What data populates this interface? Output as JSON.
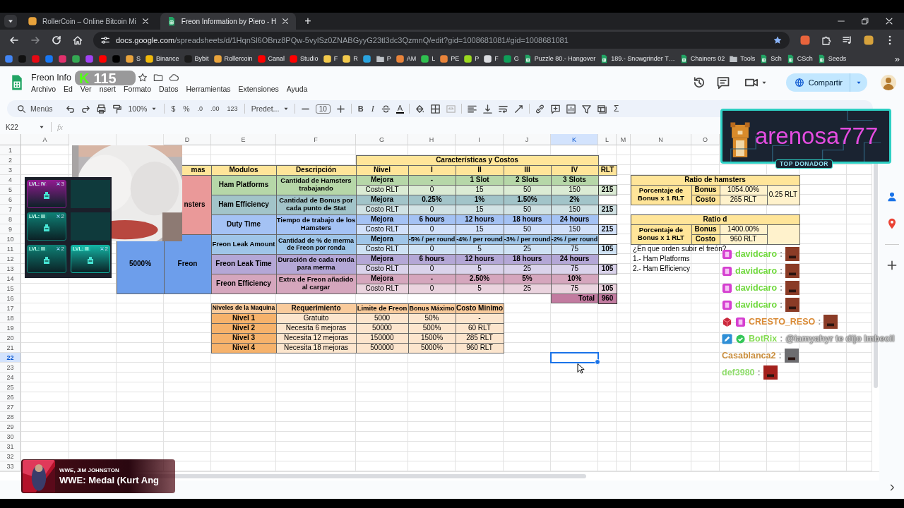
{
  "browser": {
    "tabs": [
      {
        "title": "RollerCoin – Online Bitcoin Mi",
        "kind": "site",
        "color": "#e8a33c",
        "selected": false
      },
      {
        "title": "Freon Information by Piero - H",
        "kind": "sheet",
        "color": "#21a464",
        "selected": true
      }
    ],
    "new_tab": "+",
    "url_host": "docs.google.com",
    "url_path": "/spreadsheets/d/1HqnSl6OBnz8PQw-5vylSz0ZNABGyyG23tl3dc3QzmnQ/edit?gid=1008681081#gid=1008681081",
    "bookmarks": [
      {
        "kind": "site",
        "color": "#4285f4"
      },
      {
        "kind": "site",
        "color": "#111111"
      },
      {
        "kind": "site",
        "color": "#e50914"
      },
      {
        "kind": "site",
        "color": "#1877f2"
      },
      {
        "kind": "site",
        "color": "#e1306c"
      },
      {
        "kind": "site",
        "color": "#34a853"
      },
      {
        "kind": "site",
        "color": "#a142f4"
      },
      {
        "kind": "site",
        "color": "#ff0000"
      },
      {
        "kind": "site",
        "color": "#000000"
      },
      {
        "kind": "site",
        "color": "#e8a33c",
        "label": "S"
      },
      {
        "kind": "site",
        "color": "#f0b90b",
        "label": "Binance"
      },
      {
        "kind": "site",
        "color": "#1b1b1b",
        "label": "Bybit"
      },
      {
        "kind": "site",
        "color": "#e8a33c",
        "label": "Rollercoin"
      },
      {
        "kind": "site",
        "color": "#ff0000",
        "label": "Canal"
      },
      {
        "kind": "site",
        "color": "#ff0000",
        "label": "Studio"
      },
      {
        "kind": "site",
        "color": "#f2c94c",
        "label": "F"
      },
      {
        "kind": "site",
        "color": "#f2c94c",
        "label": "R"
      },
      {
        "kind": "site",
        "color": "#2aa3de"
      },
      {
        "kind": "folder",
        "color": "#bdc1c6",
        "label": "P"
      },
      {
        "kind": "site",
        "color": "#e8833a",
        "label": "AM"
      },
      {
        "kind": "site",
        "color": "#2fbf4f",
        "label": "L"
      },
      {
        "kind": "site",
        "color": "#e8833a",
        "label": "PE"
      },
      {
        "kind": "site",
        "color": "#9ad81f",
        "label": "P"
      },
      {
        "kind": "site",
        "color": "#dadce0",
        "label": "F"
      },
      {
        "kind": "site",
        "color": "#0f9d58",
        "label": "G"
      },
      {
        "kind": "sheet",
        "color": "#21a464",
        "label": "Puzzle 80.- Hangover"
      },
      {
        "kind": "sheet",
        "color": "#21a464",
        "label": "189.- Snowgrinder T…"
      },
      {
        "kind": "sheet",
        "color": "#21a464",
        "label": "Chainers 02"
      },
      {
        "kind": "folder",
        "color": "#bdc1c6",
        "label": "Tools"
      },
      {
        "kind": "sheet",
        "color": "#21a464",
        "label": "Sch"
      },
      {
        "kind": "sheet",
        "color": "#21a464",
        "label": "CSch"
      },
      {
        "kind": "sheet",
        "color": "#21a464",
        "label": "Seeds"
      }
    ],
    "more": "»"
  },
  "document": {
    "title": "Freon Info",
    "menus": [
      "Archivo",
      "Ed",
      "Ver",
      "nsert",
      "Formato",
      "Datos",
      "Herramientas",
      "Extensiones",
      "Ayuda"
    ],
    "share": "Compartir"
  },
  "toolbar": {
    "search": "Menús",
    "zoom": "100%",
    "currency": "$",
    "percent": "%",
    "decrease_decimals": ".0",
    "increase_decimals": ".00",
    "number_format": "123",
    "font": "Predet...",
    "font_size": "10",
    "bold": "B",
    "italic": "I",
    "text_color": "A",
    "functions": "Σ"
  },
  "formula_bar": {
    "cell": "K22",
    "fx": "fx"
  },
  "sheet": {
    "columns": [
      {
        "header": "A",
        "selected": false
      },
      {},
      {},
      {
        "header": "D",
        "selected": false
      },
      {
        "header": "E",
        "selected": false
      },
      {
        "header": "F",
        "selected": false
      },
      {
        "header": "G",
        "selected": false
      },
      {
        "header": "H",
        "selected": false
      },
      {
        "header": "I",
        "selected": false
      },
      {
        "header": "J",
        "selected": false
      },
      {
        "header": "K",
        "selected": true
      },
      {
        "header": "L",
        "selected": false
      },
      {
        "header": "M",
        "selected": false
      },
      {
        "header": "N",
        "selected": false
      },
      {
        "header": "O",
        "selected": false
      },
      {},
      {},
      {},
      {}
    ],
    "rows": [
      {
        "number": "1",
        "selected": false
      },
      {
        "number": "2",
        "selected": false
      },
      {
        "number": "3",
        "selected": false
      },
      {
        "number": "4",
        "selected": false
      },
      {
        "number": "5",
        "selected": false
      },
      {
        "number": "6",
        "selected": false
      },
      {
        "number": "7",
        "selected": false
      },
      {
        "number": "8",
        "selected": false
      },
      {
        "number": "9",
        "selected": false
      },
      {
        "number": "10",
        "selected": false
      },
      {
        "number": "11",
        "selected": false
      },
      {
        "number": "12",
        "selected": false
      },
      {
        "number": "13",
        "selected": false
      },
      {
        "number": "14",
        "selected": false
      },
      {
        "number": "15",
        "selected": false
      },
      {
        "number": "16",
        "selected": false
      },
      {
        "number": "17",
        "selected": false
      },
      {
        "number": "18",
        "selected": false
      },
      {
        "number": "19",
        "selected": false
      },
      {
        "number": "20",
        "selected": false
      },
      {
        "number": "21",
        "selected": false
      },
      {
        "number": "22",
        "selected": true
      },
      {
        "number": "23",
        "selected": false
      },
      {
        "number": "24",
        "selected": false
      },
      {
        "number": "25",
        "selected": false
      },
      {
        "number": "26",
        "selected": false
      },
      {
        "number": "27",
        "selected": false
      },
      {
        "number": "28",
        "selected": false
      },
      {
        "number": "29",
        "selected": false
      },
      {
        "number": "30",
        "selected": false
      },
      {
        "number": "31",
        "selected": false
      },
      {
        "number": "32",
        "selected": false
      },
      {
        "number": "33",
        "selected": false
      }
    ],
    "main_table": {
      "title": "Características y Costos",
      "headers": [
        "mas",
        "Modulos",
        "Descripción",
        "Nivel",
        "I",
        "II",
        "III",
        "IV",
        "RLT"
      ],
      "categories": [
        {
          "name": "nsters",
          "color": "#ea9999",
          "modules": [
            {
              "name": "Ham Platforms",
              "description": "Cantidad de Hamsters trabajando",
              "color": "#b6d7a8",
              "upgrade_label": "Mejora",
              "upgrades": [
                "-",
                "1 Slot",
                "2 Slots",
                "3 Slots"
              ],
              "cost_label": "Costo RLT",
              "costs": [
                "0",
                "15",
                "50",
                "150"
              ],
              "total": "215"
            },
            {
              "name": "Ham Efficiency",
              "description": "Cantidad de Bonus por cada punto de Stat",
              "color": "#a2c4c9",
              "upgrade_label": "Mejora",
              "upgrades": [
                "0.25%",
                "1%",
                "1.50%",
                "2%"
              ],
              "cost_label": "Costo RLT",
              "costs": [
                "0",
                "15",
                "50",
                "150"
              ],
              "total": "215"
            },
            {
              "name": "Duty Time",
              "description": "Tiempo de trabajo de los Hamsters",
              "color": "#a4c2f4",
              "upgrade_label": "Mejora",
              "upgrades": [
                "6 hours",
                "12 hours",
                "18 hours",
                "24 hours"
              ],
              "cost_label": "Costo RLT",
              "costs": [
                "0",
                "15",
                "50",
                "150"
              ],
              "total": "215"
            }
          ]
        },
        {
          "value": "5000%",
          "name": "Freon",
          "color": "#6d9eeb",
          "modules": [
            {
              "name": "Freon Leak Amount",
              "description": "Cantidad de % de merma de Freon por ronda",
              "color": "#9fc5e8",
              "upgrade_label": "Mejora",
              "upgrades": [
                "-5% / per round",
                "-4% / per round",
                "-3% / per round",
                "-2% / per round"
              ],
              "cost_label": "Costo RLT",
              "costs": [
                "0",
                "5",
                "25",
                "75"
              ],
              "total": "105"
            },
            {
              "name": "Freon Leak Time",
              "description": "Duración de cada ronda para merma",
              "color": "#b4a7d6",
              "upgrade_label": "Mejora",
              "upgrades": [
                "6 hours",
                "12 hours",
                "18 hours",
                "24 hours"
              ],
              "cost_label": "Costo RLT",
              "costs": [
                "0",
                "5",
                "25",
                "75"
              ],
              "total": "105"
            },
            {
              "name": "Freon Efficiency",
              "description": "Extra de Freon añadido al cargar",
              "color": "#d5a6bd",
              "upgrade_label": "Mejora",
              "upgrades": [
                "-",
                "2.50%",
                "5%",
                "10%"
              ],
              "cost_label": "Costo RLT",
              "costs": [
                "0",
                "5",
                "25",
                "75"
              ],
              "total": "105"
            }
          ]
        }
      ],
      "total_label": "Total",
      "total": "960"
    },
    "levels_table": {
      "headers": [
        "Niveles de la Maquina",
        "Requerimiento",
        "Limite de Freon",
        "Bonus Máximo",
        "Costo Minimo"
      ],
      "rows": [
        [
          "Nivel 1",
          "Gratuito",
          "5000",
          "50%",
          "-"
        ],
        [
          "Nivel 2",
          "Necesita 6 mejoras",
          "50000",
          "500%",
          "60 RLT"
        ],
        [
          "Nivel 3",
          "Necesita 12 mejoras",
          "150000",
          "1500%",
          "285 RLT"
        ],
        [
          "Nivel 4",
          "Necesita 18 mejoras",
          "500000",
          "5000%",
          "960 RLT"
        ]
      ]
    },
    "ratio_tables": [
      {
        "title": "Ratio de hamsters",
        "label": "Porcentaje de Bonus x 1 RLT",
        "bonus_label": "Bonus",
        "bonus": "1054.00%",
        "cost_label": "Costo",
        "cost": "265 RLT",
        "rate": "0.25 RLT"
      },
      {
        "title": "Ratio d",
        "label": "Porcentaje de Bonus x 1 RLT",
        "bonus_label": "Bonus",
        "bonus": "1400.00%",
        "cost_label": "Costo",
        "cost": "960 RLT"
      }
    ],
    "notes": [
      "¿En que orden subir el freón?",
      "1.- Ham Platforms",
      "2.- Ham Efficiency"
    ]
  },
  "stream_overlays": {
    "channel_badge": {
      "logo": "K",
      "count": "115"
    },
    "game_panel": {
      "cards": [
        {
          "level": "LVL: IV",
          "count": "3",
          "color": "#8e1a8e"
        },
        {
          "level": "LVL: III",
          "count": "2",
          "color": "#0e7f74"
        },
        {
          "level": "LVL: III",
          "count": "2",
          "color": "#0e7f74"
        },
        {
          "level": "LVL: III",
          "count": "2",
          "color": "#13b3a3"
        }
      ]
    },
    "donor": {
      "name": "arenosa777",
      "badge": "TOP DONADOR"
    },
    "chat": [
      {
        "badges": [
          {
            "kind": "sub"
          }
        ],
        "user": "davidcaro",
        "color": "#6fd83c",
        "separator": ":",
        "emote": {
          "color": "#8a3b26"
        }
      },
      {
        "badges": [
          {
            "kind": "sub"
          }
        ],
        "user": "davidcaro",
        "color": "#6fd83c",
        "separator": ":",
        "emote": {
          "color": "#8a3b26"
        }
      },
      {
        "badges": [
          {
            "kind": "sub"
          }
        ],
        "user": "davidcaro",
        "color": "#6fd83c",
        "separator": ":",
        "emote": {
          "color": "#8a3b26"
        }
      },
      {
        "badges": [
          {
            "kind": "sub"
          }
        ],
        "user": "davidcaro",
        "color": "#6fd83c",
        "separator": ":",
        "emote": {
          "color": "#8a3b26"
        }
      },
      {
        "badges": [
          {
            "kind": "gift"
          },
          {
            "kind": "sub"
          }
        ],
        "user": "CRESTO_RESO",
        "color": "#d98a35",
        "separator": ":",
        "emote": {
          "color": "#8a3b26"
        }
      },
      {
        "badges": [
          {
            "kind": "mod"
          },
          {
            "kind": "verified"
          }
        ],
        "user": "BotRix",
        "color": "#86dc55",
        "separator": ":",
        "message": "@iamyahyr te dijo Imbecil"
      },
      {
        "user": "Casablanca2",
        "color": "#c98e3e",
        "separator": ":",
        "emote": {
          "color": "#6d6d70"
        }
      },
      {
        "user": "def3980",
        "color": "#8fdc6c",
        "separator": ":",
        "emote": {
          "color": "#a3201c"
        }
      }
    ],
    "now_playing": {
      "artist": "WWE, JIM JOHNSTON",
      "title": "WWE: Medal (Kurt Ang"
    }
  }
}
